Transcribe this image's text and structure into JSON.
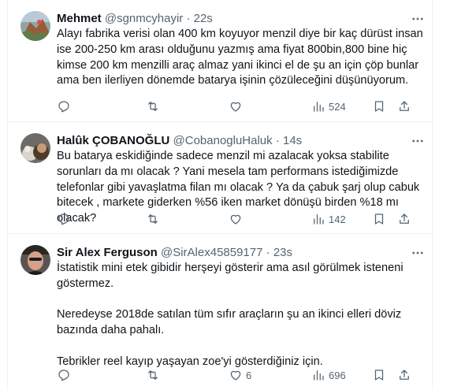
{
  "tweets": [
    {
      "name": "Mehmet",
      "handle": "@sgnmcyhayir",
      "separator": "·",
      "time": "22s",
      "paragraphs": [
        "Alayı fabrika verisi olan 400 km koyuyor menzil diye bir kaç dürüst insan ise 200-250 km arası olduğunu yazmış ama fiyat 800bin,800 bine hiç kimse 200 km menzilli araç almaz yani ikinci el de şu an için çöp bunlar ama ben ilerliyen dönemde batarya işinin çözüleceğini düşünüyorum."
      ],
      "replies": "",
      "retweets": "",
      "likes": "",
      "views": "524"
    },
    {
      "name": "Halûk ÇOBANOĞLU",
      "handle": "@CobanogluHaluk",
      "separator": "·",
      "time": "14s",
      "paragraphs": [
        "Bu batarya eskidiğinde sadece menzil mi azalacak yoksa stabilite sorunları da mı olacak ? Yani mesela tam performans istediğimizde telefonlar gibi yavaşlatma filan mı olacak ? Ya da çabuk şarj olup cabuk bitecek , markete giderken %56 iken market dönüşü birden %18 mı olacak?"
      ],
      "replies": "",
      "retweets": "",
      "likes": "",
      "views": "142"
    },
    {
      "name": "Sir Alex Ferguson",
      "handle": "@SirAlex45859177",
      "separator": "·",
      "time": "23s",
      "paragraphs": [
        "İstatistik mini etek gibidir herşeyi gösterir ama asıl görülmek isteneni göstermez.",
        "Neredeyse 2018de satılan tüm sıfır araçların şu an ikinci elleri döviz bazında daha pahalı.",
        "Tebrikler reel kayıp yaşayan zoe'yi gösterdiğiniz için."
      ],
      "replies": "",
      "retweets": "",
      "likes": "6",
      "views": "696"
    }
  ],
  "icons": {
    "reply": "reply-icon",
    "retweet": "retweet-icon",
    "like": "heart-icon",
    "views": "views-icon",
    "bookmark": "bookmark-icon",
    "share": "share-icon",
    "more": "more-icon"
  },
  "colors": {
    "text": "#0f1419",
    "secondary": "#536471",
    "border": "#eff3f4"
  }
}
